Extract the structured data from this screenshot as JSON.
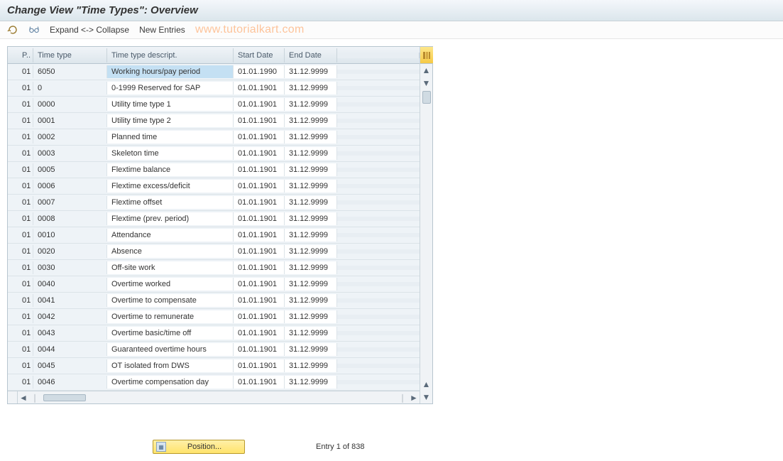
{
  "title": "Change View \"Time Types\": Overview",
  "toolbar": {
    "expand_collapse": "Expand <-> Collapse",
    "new_entries": "New Entries"
  },
  "watermark": "www.tutorialkart.com",
  "columns": {
    "p": "P..",
    "type": "Time type",
    "desc": "Time type descript.",
    "start": "Start Date",
    "end": "End Date"
  },
  "rows": [
    {
      "p": "01",
      "type": "6050",
      "desc": "Working hours/pay period",
      "start": "01.01.1990",
      "end": "31.12.9999",
      "highlight": true
    },
    {
      "p": "01",
      "type": "0",
      "desc": "0-1999 Reserved for SAP",
      "start": "01.01.1901",
      "end": "31.12.9999"
    },
    {
      "p": "01",
      "type": "0000",
      "desc": "Utility time type 1",
      "start": "01.01.1901",
      "end": "31.12.9999"
    },
    {
      "p": "01",
      "type": "0001",
      "desc": "Utility time type 2",
      "start": "01.01.1901",
      "end": "31.12.9999"
    },
    {
      "p": "01",
      "type": "0002",
      "desc": "Planned time",
      "start": "01.01.1901",
      "end": "31.12.9999"
    },
    {
      "p": "01",
      "type": "0003",
      "desc": "Skeleton time",
      "start": "01.01.1901",
      "end": "31.12.9999"
    },
    {
      "p": "01",
      "type": "0005",
      "desc": "Flextime balance",
      "start": "01.01.1901",
      "end": "31.12.9999"
    },
    {
      "p": "01",
      "type": "0006",
      "desc": "Flextime excess/deficit",
      "start": "01.01.1901",
      "end": "31.12.9999"
    },
    {
      "p": "01",
      "type": "0007",
      "desc": "Flextime offset",
      "start": "01.01.1901",
      "end": "31.12.9999"
    },
    {
      "p": "01",
      "type": "0008",
      "desc": "Flextime (prev. period)",
      "start": "01.01.1901",
      "end": "31.12.9999"
    },
    {
      "p": "01",
      "type": "0010",
      "desc": "Attendance",
      "start": "01.01.1901",
      "end": "31.12.9999"
    },
    {
      "p": "01",
      "type": "0020",
      "desc": "Absence",
      "start": "01.01.1901",
      "end": "31.12.9999"
    },
    {
      "p": "01",
      "type": "0030",
      "desc": "Off-site work",
      "start": "01.01.1901",
      "end": "31.12.9999"
    },
    {
      "p": "01",
      "type": "0040",
      "desc": "Overtime worked",
      "start": "01.01.1901",
      "end": "31.12.9999"
    },
    {
      "p": "01",
      "type": "0041",
      "desc": "Overtime to compensate",
      "start": "01.01.1901",
      "end": "31.12.9999"
    },
    {
      "p": "01",
      "type": "0042",
      "desc": "Overtime to remunerate",
      "start": "01.01.1901",
      "end": "31.12.9999"
    },
    {
      "p": "01",
      "type": "0043",
      "desc": "Overtime basic/time off",
      "start": "01.01.1901",
      "end": "31.12.9999"
    },
    {
      "p": "01",
      "type": "0044",
      "desc": "Guaranteed overtime hours",
      "start": "01.01.1901",
      "end": "31.12.9999"
    },
    {
      "p": "01",
      "type": "0045",
      "desc": "OT isolated from DWS",
      "start": "01.01.1901",
      "end": "31.12.9999"
    },
    {
      "p": "01",
      "type": "0046",
      "desc": "Overtime compensation day",
      "start": "01.01.1901",
      "end": "31.12.9999"
    }
  ],
  "footer": {
    "position_label": "Position...",
    "entry_status": "Entry 1 of 838"
  }
}
